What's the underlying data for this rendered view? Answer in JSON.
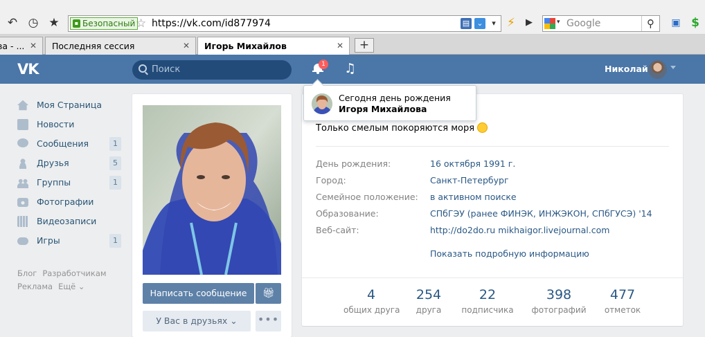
{
  "browser": {
    "secure_label": "Безопасный",
    "url": "https://vk.com/id877974",
    "search_placeholder": "Google",
    "tabs": [
      {
        "label": "ва - ..."
      },
      {
        "label": "Последняя сессия"
      },
      {
        "label": "Игорь Михайлов"
      }
    ],
    "new_tab_label": "+"
  },
  "vk_header": {
    "logo": "VK",
    "search_placeholder": "Поиск",
    "notification_count": "1",
    "user_name": "Николай"
  },
  "left_nav": {
    "items": [
      {
        "label": "Моя Страница",
        "icon": "home-icon",
        "count": ""
      },
      {
        "label": "Новости",
        "icon": "news-icon",
        "count": ""
      },
      {
        "label": "Сообщения",
        "icon": "messages-icon",
        "count": "1"
      },
      {
        "label": "Друзья",
        "icon": "friends-icon",
        "count": "5"
      },
      {
        "label": "Группы",
        "icon": "groups-icon",
        "count": "1"
      },
      {
        "label": "Фотографии",
        "icon": "camera-icon",
        "count": ""
      },
      {
        "label": "Видеозаписи",
        "icon": "video-icon",
        "count": ""
      },
      {
        "label": "Игры",
        "icon": "gamepad-icon",
        "count": "1"
      }
    ],
    "footer": [
      "Блог",
      "Разработчикам",
      "Реклама",
      "Ещё ⌄"
    ]
  },
  "profile": {
    "write_message": "Написать сообщение",
    "friends_button": "У Вас в друзьях ⌄",
    "dots": "•••",
    "status": "Только смелым покоряются моря",
    "info": [
      {
        "key": "День рождения:",
        "value": "16 октября 1991 г."
      },
      {
        "key": "Город:",
        "value": "Санкт-Петербург"
      },
      {
        "key": "Семейное положение:",
        "value": "в активном поиске"
      },
      {
        "key": "Образование:",
        "value": "СПбГЭУ (ранее ФИНЭК, ИНЖЭКОН, СПбГУСЭ) '14"
      },
      {
        "key": "Веб-сайт:",
        "value": "http://do2do.ru mikhaigor.livejournal.com"
      }
    ],
    "show_more": "Показать подробную информацию",
    "counters": [
      {
        "number": "4",
        "label": "общих друга"
      },
      {
        "number": "254",
        "label": "друга"
      },
      {
        "number": "22",
        "label": "подписчика"
      },
      {
        "number": "398",
        "label": "фотографий"
      },
      {
        "number": "477",
        "label": "отметок"
      }
    ]
  },
  "notification": {
    "text_prefix": "Сегодня день рождения ",
    "name": "Игоря Михайлова"
  }
}
